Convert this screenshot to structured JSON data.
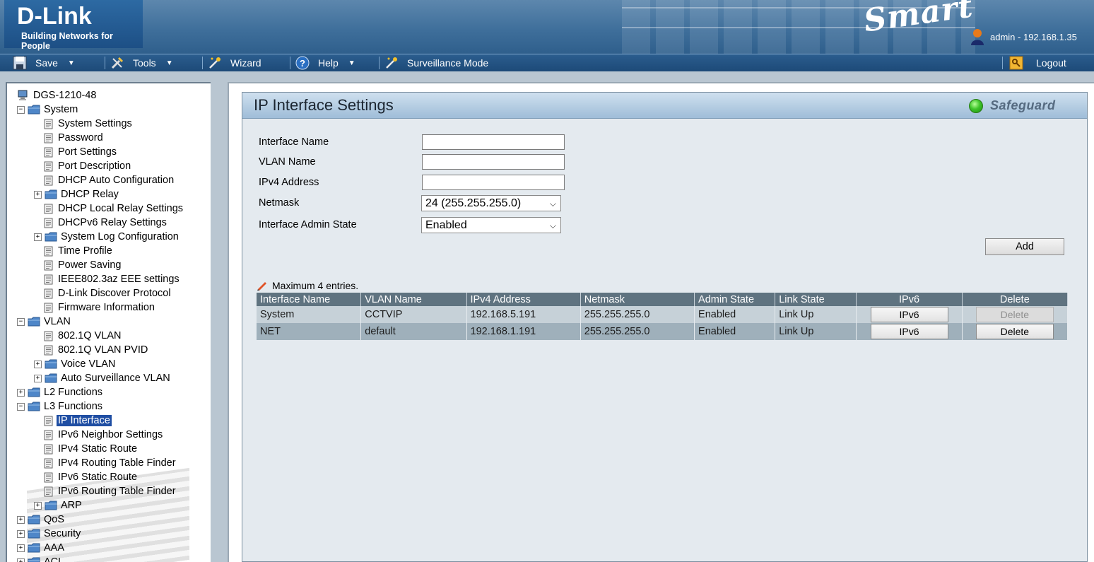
{
  "header": {
    "logo": "D-Link",
    "tagline": "Building Networks for People",
    "smart_logo": "Smart",
    "user": "admin - 192.168.1.35"
  },
  "toolbar": {
    "save": "Save",
    "tools": "Tools",
    "wizard": "Wizard",
    "help": "Help",
    "surveillance": "Surveillance Mode",
    "logout": "Logout"
  },
  "tree": {
    "root": "DGS-1210-48",
    "items": [
      {
        "label": "System",
        "type": "folder",
        "state": "expanded",
        "level": 0
      },
      {
        "label": "System Settings",
        "type": "doc",
        "level": 1
      },
      {
        "label": "Password",
        "type": "doc",
        "level": 1
      },
      {
        "label": "Port Settings",
        "type": "doc",
        "level": 1
      },
      {
        "label": "Port Description",
        "type": "doc",
        "level": 1
      },
      {
        "label": "DHCP Auto Configuration",
        "type": "doc",
        "level": 1
      },
      {
        "label": "DHCP Relay",
        "type": "folder",
        "state": "collapsed",
        "level": 1
      },
      {
        "label": "DHCP Local Relay Settings",
        "type": "doc",
        "level": 1
      },
      {
        "label": "DHCPv6 Relay Settings",
        "type": "doc",
        "level": 1
      },
      {
        "label": "System Log Configuration",
        "type": "folder",
        "state": "collapsed",
        "level": 1
      },
      {
        "label": "Time Profile",
        "type": "doc",
        "level": 1
      },
      {
        "label": "Power Saving",
        "type": "doc",
        "level": 1
      },
      {
        "label": "IEEE802.3az EEE settings",
        "type": "doc",
        "level": 1
      },
      {
        "label": "D-Link Discover Protocol",
        "type": "doc",
        "level": 1
      },
      {
        "label": "Firmware Information",
        "type": "doc",
        "level": 1
      },
      {
        "label": "VLAN",
        "type": "folder",
        "state": "expanded",
        "level": 0
      },
      {
        "label": "802.1Q VLAN",
        "type": "doc",
        "level": 1
      },
      {
        "label": "802.1Q VLAN PVID",
        "type": "doc",
        "level": 1
      },
      {
        "label": "Voice VLAN",
        "type": "folder",
        "state": "collapsed",
        "level": 1
      },
      {
        "label": "Auto Surveillance VLAN",
        "type": "folder",
        "state": "collapsed",
        "level": 1
      },
      {
        "label": "L2 Functions",
        "type": "folder",
        "state": "collapsed",
        "level": 0
      },
      {
        "label": "L3 Functions",
        "type": "folder",
        "state": "expanded",
        "level": 0
      },
      {
        "label": "IP Interface",
        "type": "doc",
        "level": 1,
        "selected": true
      },
      {
        "label": "IPv6 Neighbor Settings",
        "type": "doc",
        "level": 1
      },
      {
        "label": "IPv4 Static Route",
        "type": "doc",
        "level": 1
      },
      {
        "label": "IPv4 Routing Table Finder",
        "type": "doc",
        "level": 1
      },
      {
        "label": "IPv6 Static Route",
        "type": "doc",
        "level": 1
      },
      {
        "label": "IPv6 Routing Table Finder",
        "type": "doc",
        "level": 1
      },
      {
        "label": "ARP",
        "type": "folder",
        "state": "collapsed",
        "level": 1
      },
      {
        "label": "QoS",
        "type": "folder",
        "state": "collapsed",
        "level": 0
      },
      {
        "label": "Security",
        "type": "folder",
        "state": "collapsed",
        "level": 0
      },
      {
        "label": "AAA",
        "type": "folder",
        "state": "collapsed",
        "level": 0
      },
      {
        "label": "ACL",
        "type": "folder",
        "state": "collapsed",
        "level": 0
      }
    ]
  },
  "page": {
    "title": "IP Interface Settings",
    "safeguard": "Safeguard",
    "form": {
      "interface_name_label": "Interface Name",
      "interface_name_value": "",
      "vlan_name_label": "VLAN Name",
      "vlan_name_value": "",
      "ipv4_label": "IPv4 Address",
      "ipv4_value": "",
      "netmask_label": "Netmask",
      "netmask_value": "24 (255.255.255.0)",
      "admin_state_label": "Interface Admin State",
      "admin_state_value": "Enabled",
      "add_button": "Add"
    },
    "note": "Maximum 4 entries.",
    "table": {
      "headers": [
        "Interface Name",
        "VLAN Name",
        "IPv4 Address",
        "Netmask",
        "Admin State",
        "Link State",
        "IPv6",
        "Delete"
      ],
      "rows": [
        {
          "interface": "System",
          "vlan": "CCTVIP",
          "ipv4": "192.168.5.191",
          "netmask": "255.255.255.0",
          "admin": "Enabled",
          "link": "Link Up",
          "ipv6_btn": "IPv6",
          "delete_btn": "Delete",
          "delete_disabled": true
        },
        {
          "interface": "NET",
          "vlan": "default",
          "ipv4": "192.168.1.191",
          "netmask": "255.255.255.0",
          "admin": "Enabled",
          "link": "Link Up",
          "ipv6_btn": "IPv6",
          "delete_btn": "Delete",
          "delete_disabled": false
        }
      ]
    }
  },
  "colors": {
    "header_bg": "#3f6f9b",
    "toolbar_bg": "#2b5d8e",
    "table_header": "#5f7380",
    "row_light": "#c6d1d8",
    "row_dark": "#9fb0bb",
    "selected": "#1f4ea3",
    "safeguard_led": "#3ec52a"
  }
}
